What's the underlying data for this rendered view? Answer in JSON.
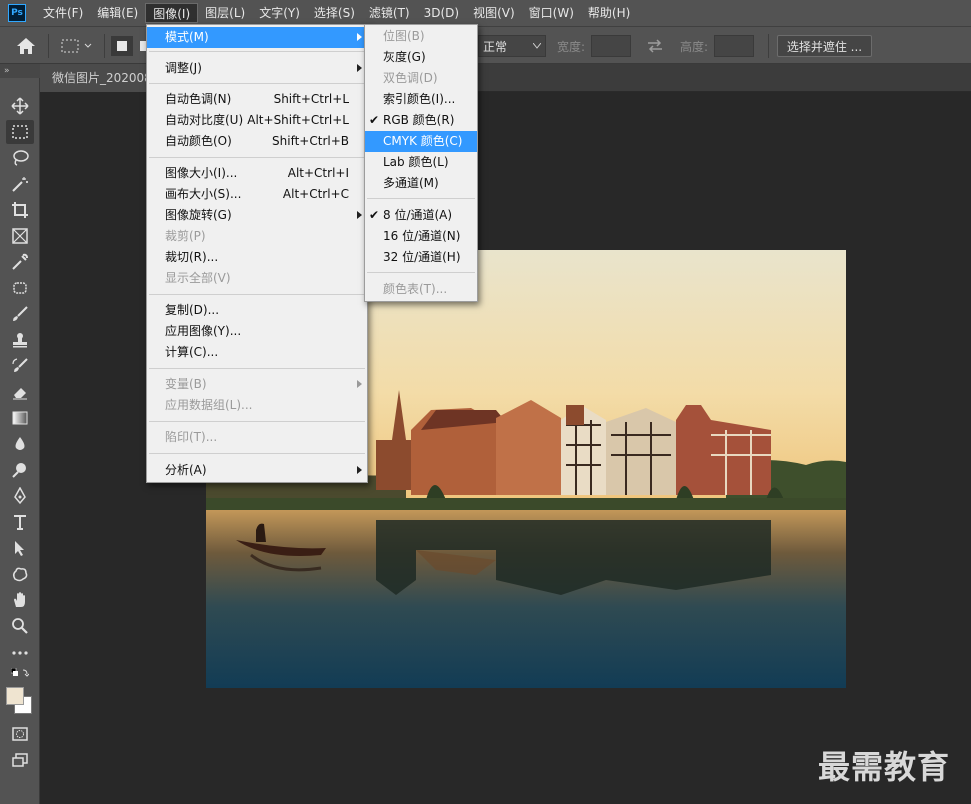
{
  "menubar": {
    "logo": "Ps",
    "items": [
      "文件(F)",
      "编辑(E)",
      "图像(I)",
      "图层(L)",
      "文字(Y)",
      "选择(S)",
      "滤镜(T)",
      "3D(D)",
      "视图(V)",
      "窗口(W)",
      "帮助(H)"
    ],
    "active_index": 2
  },
  "options_bar": {
    "style_value": "正常",
    "width_label": "宽度:",
    "height_label": "高度:",
    "select_mask_button": "选择并遮住 ..."
  },
  "document_tab": {
    "title": "微信图片_202008"
  },
  "image_menu": {
    "items": [
      {
        "label": "模式(M)",
        "shortcut": "",
        "submenu": true,
        "disabled": false,
        "highlighted": true
      },
      {
        "label": "调整(J)",
        "shortcut": "",
        "submenu": true,
        "disabled": false
      },
      {
        "label": "自动色调(N)",
        "shortcut": "Shift+Ctrl+L",
        "disabled": false
      },
      {
        "label": "自动对比度(U)",
        "shortcut": "Alt+Shift+Ctrl+L",
        "disabled": false
      },
      {
        "label": "自动颜色(O)",
        "shortcut": "Shift+Ctrl+B",
        "disabled": false
      },
      {
        "label": "图像大小(I)...",
        "shortcut": "Alt+Ctrl+I",
        "disabled": false
      },
      {
        "label": "画布大小(S)...",
        "shortcut": "Alt+Ctrl+C",
        "disabled": false
      },
      {
        "label": "图像旋转(G)",
        "shortcut": "",
        "submenu": true,
        "disabled": false
      },
      {
        "label": "裁剪(P)",
        "shortcut": "",
        "disabled": true
      },
      {
        "label": "裁切(R)...",
        "shortcut": "",
        "disabled": false
      },
      {
        "label": "显示全部(V)",
        "shortcut": "",
        "disabled": true
      },
      {
        "label": "复制(D)...",
        "shortcut": "",
        "disabled": false
      },
      {
        "label": "应用图像(Y)...",
        "shortcut": "",
        "disabled": false
      },
      {
        "label": "计算(C)...",
        "shortcut": "",
        "disabled": false
      },
      {
        "label": "变量(B)",
        "shortcut": "",
        "submenu": true,
        "disabled": true
      },
      {
        "label": "应用数据组(L)...",
        "shortcut": "",
        "disabled": true
      },
      {
        "label": "陷印(T)...",
        "shortcut": "",
        "disabled": true
      },
      {
        "label": "分析(A)",
        "shortcut": "",
        "submenu": true,
        "disabled": false
      }
    ]
  },
  "mode_submenu": {
    "items": [
      {
        "label": "位图(B)",
        "checked": false,
        "disabled": true
      },
      {
        "label": "灰度(G)",
        "checked": false,
        "disabled": false
      },
      {
        "label": "双色调(D)",
        "checked": false,
        "disabled": true
      },
      {
        "label": "索引颜色(I)...",
        "checked": false,
        "disabled": false
      },
      {
        "label": "RGB 颜色(R)",
        "checked": true,
        "disabled": false
      },
      {
        "label": "CMYK 颜色(C)",
        "checked": false,
        "disabled": false,
        "highlighted": true
      },
      {
        "label": "Lab 颜色(L)",
        "checked": false,
        "disabled": false
      },
      {
        "label": "多通道(M)",
        "checked": false,
        "disabled": false
      },
      {
        "label": "8 位/通道(A)",
        "checked": true,
        "disabled": false
      },
      {
        "label": "16 位/通道(N)",
        "checked": false,
        "disabled": false
      },
      {
        "label": "32 位/通道(H)",
        "checked": false,
        "disabled": false
      },
      {
        "label": "颜色表(T)...",
        "checked": false,
        "disabled": true
      }
    ]
  },
  "watermark": "最需教育",
  "colors": {
    "highlight": "#3399ff",
    "panel": "#535353",
    "canvas_bg": "#282828",
    "menu_bg": "#f0f0f0"
  }
}
